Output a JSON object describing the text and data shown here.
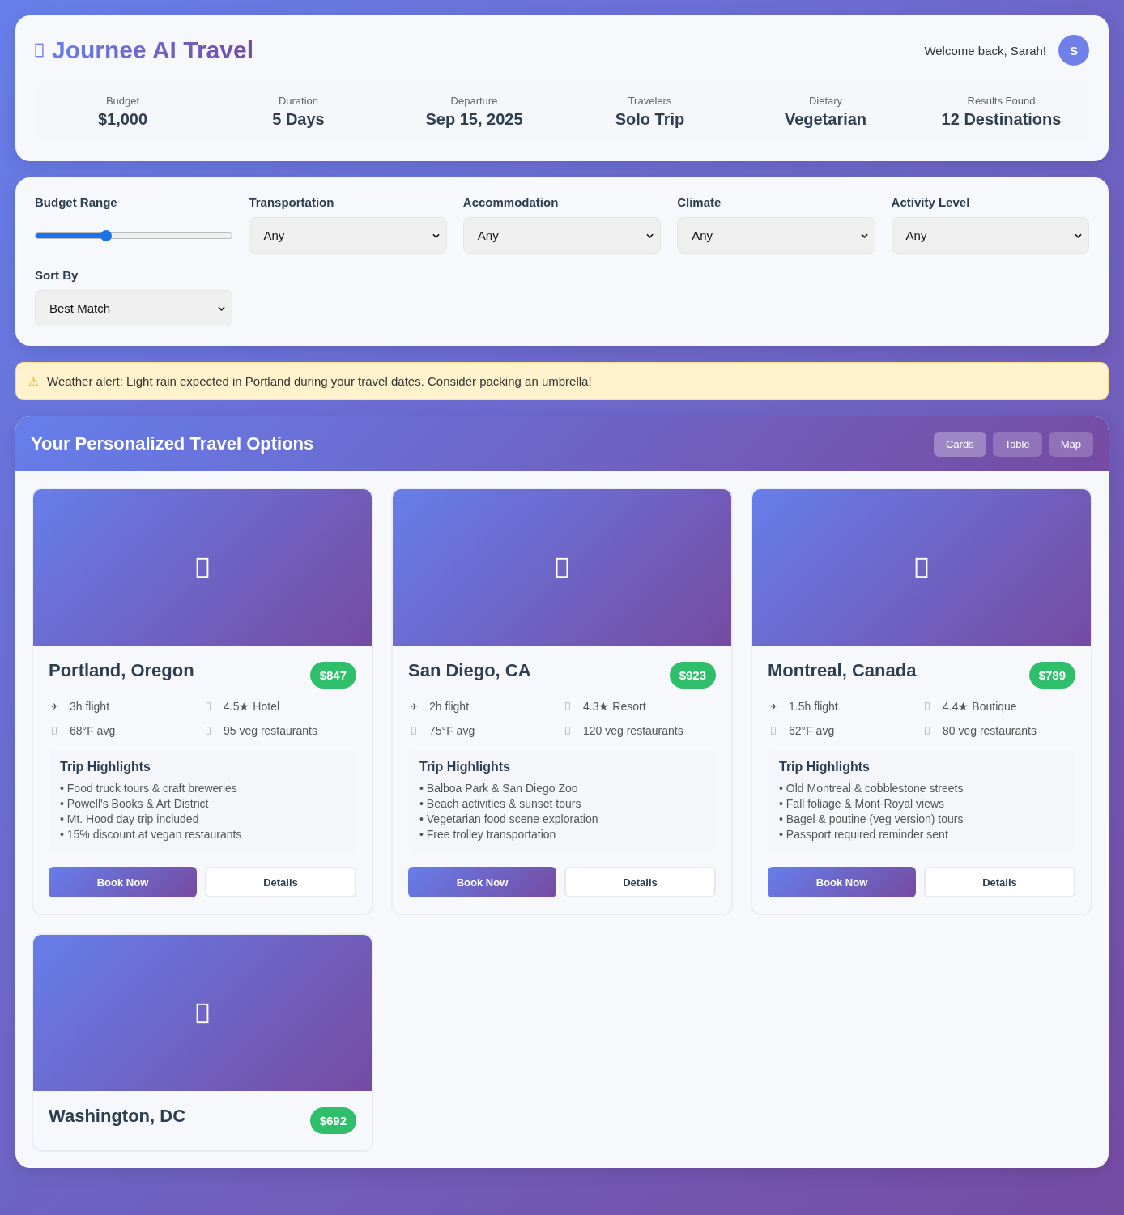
{
  "header": {
    "title": "Journee AI Travel",
    "welcome": "Welcome back, Sarah!",
    "avatar": "S"
  },
  "summary": [
    {
      "label": "Budget",
      "value": "$1,000"
    },
    {
      "label": "Duration",
      "value": "5 Days"
    },
    {
      "label": "Departure",
      "value": "Sep 15, 2025"
    },
    {
      "label": "Travelers",
      "value": "Solo Trip"
    },
    {
      "label": "Dietary",
      "value": "Vegetarian"
    },
    {
      "label": "Results Found",
      "value": "12 Destinations"
    }
  ],
  "filters": [
    {
      "kind": "slider",
      "label": "Budget Range",
      "level": 0.36
    },
    {
      "kind": "select",
      "label": "Transportation",
      "value": "Any"
    },
    {
      "kind": "select",
      "label": "Accommodation",
      "value": "Any"
    },
    {
      "kind": "select",
      "label": "Climate",
      "value": "Any"
    },
    {
      "kind": "select",
      "label": "Activity Level",
      "value": "Any"
    },
    {
      "kind": "select",
      "label": "Sort By",
      "value": "Best Match"
    }
  ],
  "alert": {
    "icon": "⚠",
    "text": "Weather alert: Light rain expected in Portland during your travel dates. Consider packing an umbrella!"
  },
  "results": {
    "title": "Your Personalized Travel Options",
    "views": [
      {
        "label": "Cards",
        "selected": true
      },
      {
        "label": "Table",
        "selected": false
      },
      {
        "label": "Map",
        "selected": false
      }
    ],
    "destinations": [
      {
        "name": "Portland, Oregon",
        "price": "$847",
        "facts": [
          {
            "icon": "✈",
            "text": "3h flight"
          },
          {
            "text": "4.5★ Hotel"
          },
          {
            "text": "68°F avg"
          },
          {
            "text": "95 veg restaurants"
          }
        ],
        "highlights_title": "Trip Highlights",
        "highlights": [
          "• Food truck tours & craft breweries",
          "• Powell's Books & Art District",
          "• Mt. Hood day trip included",
          "• 15% discount at vegan restaurants"
        ],
        "buttons": [
          "Book Now",
          "Details"
        ]
      },
      {
        "name": "San Diego, CA",
        "price": "$923",
        "facts": [
          {
            "icon": "✈",
            "text": "2h flight"
          },
          {
            "text": "4.3★ Resort"
          },
          {
            "text": "75°F avg"
          },
          {
            "text": "120 veg restaurants"
          }
        ],
        "highlights_title": "Trip Highlights",
        "highlights": [
          "• Balboa Park & San Diego Zoo",
          "• Beach activities & sunset tours",
          "• Vegetarian food scene exploration",
          "• Free trolley transportation"
        ],
        "buttons": [
          "Book Now",
          "Details"
        ]
      },
      {
        "name": "Montreal, Canada",
        "price": "$789",
        "facts": [
          {
            "icon": "✈",
            "text": "1.5h flight"
          },
          {
            "text": "4.4★ Boutique"
          },
          {
            "text": "62°F avg"
          },
          {
            "text": "80 veg restaurants"
          }
        ],
        "highlights_title": "Trip Highlights",
        "highlights": [
          "• Old Montreal & cobblestone streets",
          "• Fall foliage & Mont-Royal views",
          "• Bagel & poutine (veg version) tours",
          "• Passport required reminder sent"
        ],
        "buttons": [
          "Book Now",
          "Details"
        ]
      },
      {
        "name": "Washington, DC",
        "price": "$692"
      }
    ]
  }
}
